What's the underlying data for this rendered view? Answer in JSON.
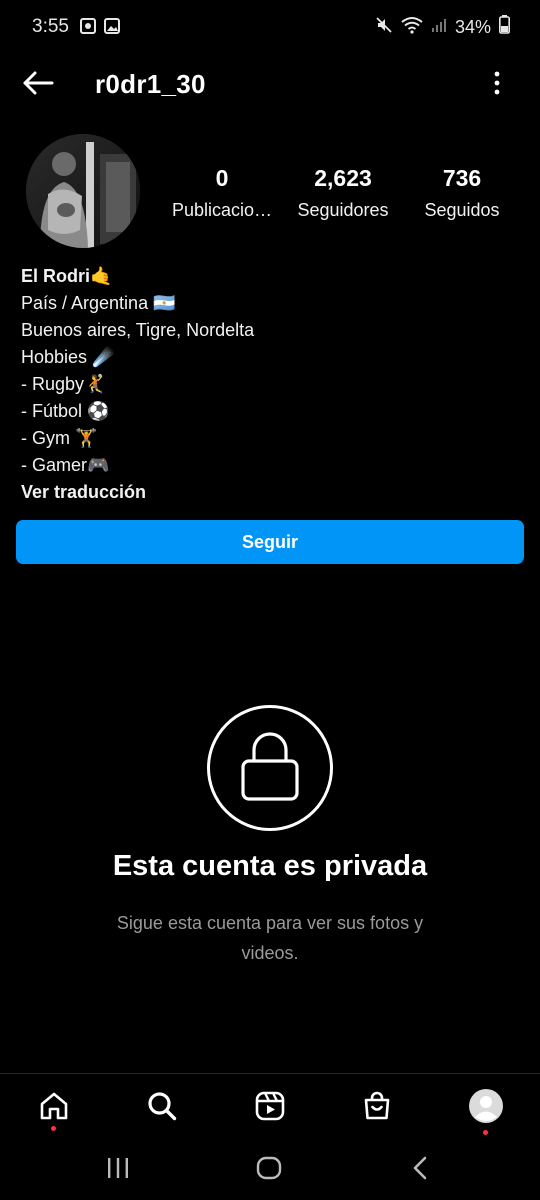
{
  "status_bar": {
    "time": "3:55",
    "battery": "34%"
  },
  "header": {
    "username": "r0dr1_30"
  },
  "stats": [
    {
      "value": "0",
      "label": "Publicacio…"
    },
    {
      "value": "2,623",
      "label": "Seguidores"
    },
    {
      "value": "736",
      "label": "Seguidos"
    }
  ],
  "bio": {
    "name": "El Rodri🤙",
    "lines": [
      "País / Argentina 🇦🇷",
      "Buenos aires, Tigre, Nordelta",
      "Hobbies ☄️",
      "- Rugby🤾",
      "- Fútbol ⚽",
      "- Gym 🏋",
      "- Gamer🎮"
    ],
    "translate_link": "Ver traducción"
  },
  "follow_button": "Seguir",
  "private": {
    "title": "Esta cuenta es privada",
    "description": "Sigue esta cuenta para ver sus fotos y videos."
  },
  "colors": {
    "accent": "#0095f6",
    "notification_dot": "#ff3040",
    "muted_text": "#9a9a9a"
  },
  "icons": {
    "back": "back-arrow-icon",
    "more": "more-vertical-icon",
    "lock": "lock-icon",
    "home": "home-icon",
    "search": "search-icon",
    "reels": "reels-icon",
    "shop": "shop-icon",
    "profile": "profile-avatar-icon"
  }
}
